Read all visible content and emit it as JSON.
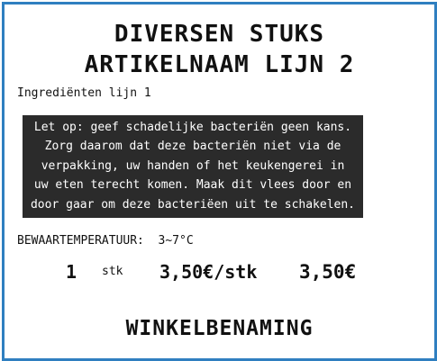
{
  "label": {
    "title_line1": "DIVERSEN STUKS",
    "title_line2": "ARTIKELNAAM LIJN 2",
    "ingredients": "Ingrediënten lijn 1",
    "warning": "Let op: geef schadelijke bacteriën geen kans.\nZorg daarom dat deze bacteriën niet via de\nverpakking, uw handen of het keukengerei in\nuw eten terecht komen. Maak dit vlees door en\ndoor gaar om deze bacteriëen uit te schakelen.",
    "storage": "BEWAARTEMPERATUUR:  3~7°C",
    "quantity": "1",
    "unit": "stk",
    "unit_price": "3,50€/stk",
    "total": "3,50€",
    "store_name": "WINKELBENAMING"
  },
  "colors": {
    "border": "#2f7fc0",
    "warning_background": "#2b2b2b",
    "text": "#111111"
  }
}
